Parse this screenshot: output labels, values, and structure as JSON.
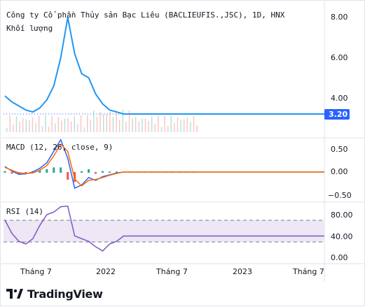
{
  "header": {
    "symbol_title": "Công ty Cổ phần Thủy sản Bạc Liêu (BACLIEUFIS.,JSC), 1D, HNX",
    "volume_label": "Khối lượng"
  },
  "price_axis": {
    "ticks": [
      "8.00",
      "6.00",
      "4.00"
    ],
    "current_price": "3.20"
  },
  "macd": {
    "title": "MACD (12, 26, close, 9)",
    "ticks": [
      "0.50",
      "0.00",
      "−0.50"
    ],
    "colors": {
      "macd_line": "#2962ff",
      "signal_line": "#ff6d00",
      "hist_pos": "#26a69a",
      "hist_neg": "#ef5350"
    }
  },
  "rsi": {
    "title": "RSI (14)",
    "ticks": [
      "80.00",
      "40.00",
      "0.00"
    ],
    "colors": {
      "line": "#7e57c2",
      "band": "#ede7f6"
    }
  },
  "x_axis": {
    "labels": [
      "Tháng 7",
      "2022",
      "Tháng 7",
      "2023",
      "Tháng 7"
    ]
  },
  "footer": {
    "brand": "TradingView"
  },
  "chart_data": [
    {
      "type": "line",
      "title": "Công ty Cổ phần Thủy sản Bạc Liêu (BACLIEUFIS.,JSC), 1D, HNX",
      "ylim": [
        3.0,
        8.4
      ],
      "x": [
        "2021-04",
        "2021-05",
        "2021-06",
        "2021-07",
        "2021-08",
        "2021-09",
        "2021-10",
        "2021-11",
        "2021-12",
        "2022-01",
        "2022-02",
        "2022-03",
        "2022-04",
        "2022-05",
        "2022-06",
        "2022-07",
        "2022-08",
        "2022-09",
        "2022-10",
        "2022-11",
        "2022-12",
        "2023-01",
        "2023-02",
        "2023-03",
        "2023-04",
        "2023-05",
        "2023-06",
        "2023-07",
        "2023-08"
      ],
      "series": [
        {
          "values": [
            4.1,
            3.8,
            3.6,
            3.4,
            3.3,
            3.5,
            3.9,
            4.6,
            6.0,
            8.0,
            6.2,
            5.2,
            5.0,
            4.2,
            3.7,
            3.4,
            3.3,
            3.2,
            3.2,
            3.2,
            3.2,
            3.2,
            3.2,
            3.2,
            3.2,
            3.2,
            3.2,
            3.2,
            3.2
          ]
        }
      ]
    },
    {
      "type": "line",
      "title": "MACD (12, 26, close, 9)",
      "ylim": [
        -0.55,
        0.75
      ],
      "series": [
        {
          "values": [
            0.12,
            0.02,
            -0.05,
            -0.04,
            0.0,
            0.08,
            0.2,
            0.45,
            0.7,
            0.3,
            -0.35,
            -0.28,
            -0.12,
            -0.18,
            -0.1,
            -0.06,
            -0.02,
            0.0,
            0.0,
            0.0,
            0.0,
            0.0,
            0.0,
            0.0,
            0.0,
            0.0,
            0.0,
            0.0,
            0.0
          ]
        },
        {
          "values": [
            0.1,
            0.04,
            -0.02,
            -0.03,
            -0.02,
            0.04,
            0.14,
            0.35,
            0.6,
            0.45,
            -0.15,
            -0.3,
            -0.18,
            -0.16,
            -0.12,
            -0.07,
            -0.03,
            0.0,
            0.0,
            0.0,
            0.0,
            0.0,
            0.0,
            0.0,
            0.0,
            0.0,
            0.0,
            0.0,
            0.0
          ]
        }
      ]
    },
    {
      "type": "line",
      "title": "RSI (14)",
      "ylim": [
        0,
        100
      ],
      "series": [
        {
          "values": [
            70,
            45,
            30,
            25,
            35,
            60,
            80,
            85,
            95,
            96,
            40,
            35,
            30,
            20,
            12,
            25,
            30,
            40,
            40,
            40,
            40,
            40,
            40,
            40,
            40,
            40,
            40,
            40,
            40
          ]
        }
      ]
    }
  ]
}
